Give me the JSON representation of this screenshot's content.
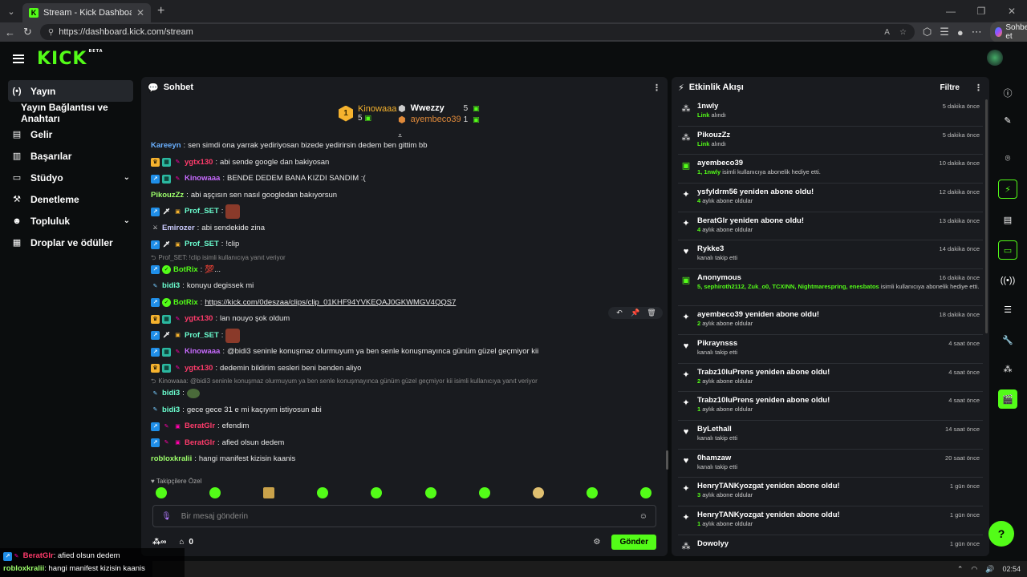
{
  "browser": {
    "tab_title": "Stream - Kick Dashboard",
    "url": "https://dashboard.kick.com/stream",
    "copilot_label": "Sohbet et"
  },
  "header": {
    "logo": "KICK",
    "beta": "BETA"
  },
  "sidebar": {
    "items": [
      {
        "label": "Yayın",
        "icon": "broadcast-icon"
      },
      {
        "label": "Yayın Bağlantısı ve Anahtarı",
        "icon": ""
      },
      {
        "label": "Gelir",
        "icon": "revenue-icon"
      },
      {
        "label": "Başarılar",
        "icon": "achievements-icon"
      },
      {
        "label": "Stüdyo",
        "icon": "studio-icon"
      },
      {
        "label": "Denetleme",
        "icon": "moderation-icon"
      },
      {
        "label": "Topluluk",
        "icon": "community-icon"
      },
      {
        "label": "Droplar ve ödüller",
        "icon": "drops-icon"
      }
    ]
  },
  "chat": {
    "title": "Sohbet",
    "leaderboard": {
      "first": {
        "rank": "1",
        "name": "Kinowaaa",
        "count": "5"
      },
      "second": {
        "name": "Wwezzy",
        "count": "5"
      },
      "third": {
        "name": "ayembeco39",
        "count": "1"
      }
    },
    "messages": [
      {
        "user": "Kareeyn",
        "text": "sen simdi ona yarrak yediriyosan bizede yedirirsin dedem ben gittim bb"
      },
      {
        "user": "ygtx130",
        "text": "abi sende google dan bakiyosan"
      },
      {
        "user": "Kinowaaa",
        "text": "BENDE DEDEM BANA KIZDI SANDIM :("
      },
      {
        "user": "PikouzZz",
        "text": "abi aşçısın sen nasıl googledan bakıyorsun"
      },
      {
        "user": "Prof_SET",
        "text": ""
      },
      {
        "user": "Emirozer",
        "text": "abi sendekide zina"
      },
      {
        "user": "Prof_SET",
        "text": "!clip"
      },
      {
        "reply": "Prof_SET: !clip isimli kullanıcıya yanıt veriyor"
      },
      {
        "user": "BotRix",
        "text": "💯..."
      },
      {
        "user": "bidi3",
        "text": "konuyu degissek mi"
      },
      {
        "user": "BotRix",
        "text": "https://kick.com/0deszaa/clips/clip_01KHF94YVKEQAJ0GKWMGV4QQS7"
      },
      {
        "user": "ygtx130",
        "text": "lan nouyo şok oldum"
      },
      {
        "user": "Prof_SET",
        "text": ""
      },
      {
        "user": "Kinowaaa",
        "text": "@bidi3 seninle konuşmaz olurmuyum ya ben senle konuşmayınca günüm güzel geçmiyor kii"
      },
      {
        "user": "ygtx130",
        "text": "dedemin bildirim sesleri beni benden aliyo"
      },
      {
        "reply": "Kinowaaa: @bidi3 seninle konuşmaz olurmuyum ya ben senle konuşmayınca günüm güzel geçmiyor kii isimli kullanıcıya yanıt veriyor"
      },
      {
        "user": "bidi3",
        "text": ""
      },
      {
        "user": "bidi3",
        "text": "gece gece 31 e mi kaçıyım istiyosun abi"
      },
      {
        "user": "BeratGlr",
        "text": "efendim"
      },
      {
        "user": "BeratGlr",
        "text": "afied olsun dedem"
      },
      {
        "user": "robloxkralii",
        "text": "hangi manifest kizisin kaanis"
      }
    ],
    "sub_only": "Takipçilere Özel",
    "input_placeholder": "Bir mesaj gönderin",
    "points": "0",
    "send_label": "Gönder"
  },
  "activity": {
    "title": "Etkinlik Akışı",
    "filter_label": "Filtre",
    "items": [
      {
        "icon": "link-icon",
        "title": "1nwly",
        "detail_hl": "Link",
        "detail": "alındı",
        "time": "5 dakika önce"
      },
      {
        "icon": "link-icon",
        "title": "PikouzZz",
        "detail_hl": "Link",
        "detail": "alındı",
        "time": "5 dakika önce"
      },
      {
        "icon": "gift-icon",
        "title": "ayembeco39",
        "detail_hl": "1, 1nwly",
        "detail": "isimli kullanıcıya abonelik hediye etti.",
        "time": "10 dakika önce"
      },
      {
        "icon": "sparkle-icon",
        "title": "ysfyldrm56 yeniden abone oldu!",
        "detail_hl": "4",
        "detail": "aylık abone oldular",
        "time": "12 dakika önce"
      },
      {
        "icon": "sparkle-icon",
        "title": "BeratGlr yeniden abone oldu!",
        "detail_hl": "4",
        "detail": "aylık abone oldular",
        "time": "13 dakika önce"
      },
      {
        "icon": "heart-icon",
        "title": "Rykke3",
        "detail_hl": "",
        "detail": "kanalı takip etti",
        "time": "14 dakika önce"
      },
      {
        "icon": "gift-icon",
        "title": "Anonymous",
        "detail_hl": "5, sephiroth2112, Zuk_o0, TCXINN, Nightmarespring, enesbatos",
        "detail": "isimli kullanıcıya abonelik hediye etti.",
        "time": "16 dakika önce"
      },
      {
        "icon": "sparkle-icon",
        "title": "ayembeco39 yeniden abone oldu!",
        "detail_hl": "2",
        "detail": "aylık abone oldular",
        "time": "18 dakika önce"
      },
      {
        "icon": "heart-icon",
        "title": "Pikraynsss",
        "detail_hl": "",
        "detail": "kanalı takip etti",
        "time": "4 saat önce"
      },
      {
        "icon": "sparkle-icon",
        "title": "Trabz10luPrens yeniden abone oldu!",
        "detail_hl": "2",
        "detail": "aylık abone oldular",
        "time": "4 saat önce"
      },
      {
        "icon": "sparkle-icon",
        "title": "Trabz10luPrens yeniden abone oldu!",
        "detail_hl": "1",
        "detail": "aylık abone oldular",
        "time": "4 saat önce"
      },
      {
        "icon": "heart-icon",
        "title": "ByLethall",
        "detail_hl": "",
        "detail": "kanalı takip etti",
        "time": "14 saat önce"
      },
      {
        "icon": "heart-icon",
        "title": "0hamzaw",
        "detail_hl": "",
        "detail": "kanalı takip etti",
        "time": "20 saat önce"
      },
      {
        "icon": "sparkle-icon",
        "title": "HenryTANKyozgat yeniden abone oldu!",
        "detail_hl": "3",
        "detail": "aylık abone oldular",
        "time": "1 gün önce"
      },
      {
        "icon": "sparkle-icon",
        "title": "HenryTANKyozgat yeniden abone oldu!",
        "detail_hl": "1",
        "detail": "aylık abone oldular",
        "time": "1 gün önce"
      },
      {
        "icon": "link-icon",
        "title": "Dowolyy",
        "detail_hl": "",
        "detail": "",
        "time": "1 gün önce"
      }
    ]
  },
  "overlay": {
    "line1_user": "BeratGlr",
    "line1_text": ": afied olsun dedem",
    "line2_user": "robloxkralii",
    "line2_text": ": hangi manifest kizisin kaanis"
  },
  "taskbar": {
    "time": "02:54"
  },
  "colors": {
    "accent": "#53fc18",
    "panel": "#191b1f",
    "background": "#0b0d0e"
  }
}
